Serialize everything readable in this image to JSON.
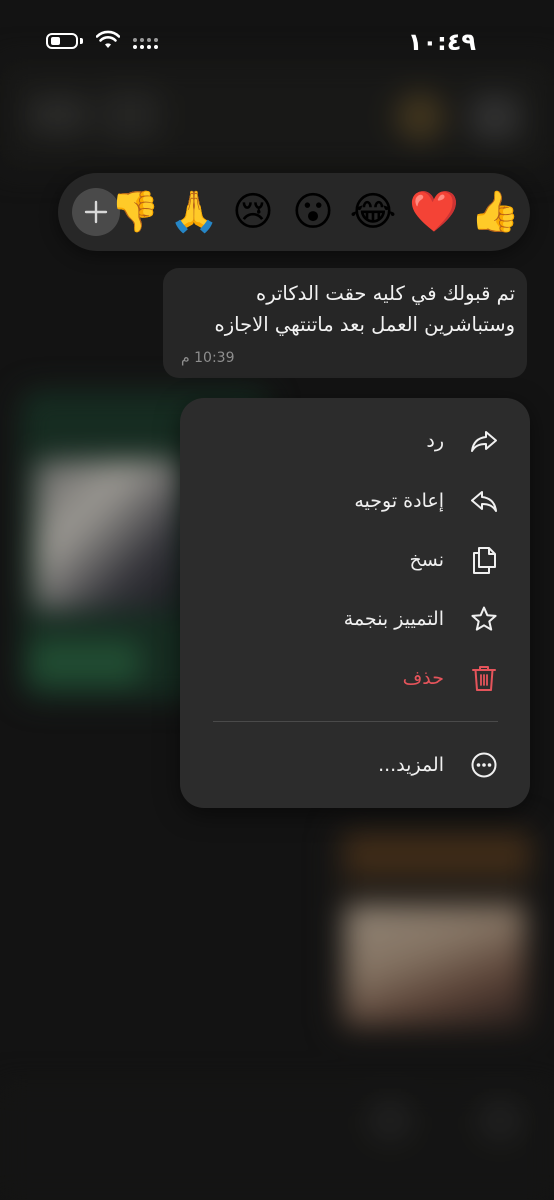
{
  "status_bar": {
    "time": "١٠:٤٩"
  },
  "reactions": [
    {
      "emoji": "👍",
      "icon": "thumbs-up"
    },
    {
      "emoji": "❤️",
      "icon": "red-heart"
    },
    {
      "emoji": "😂",
      "icon": "tears-of-joy"
    },
    {
      "emoji": "😮",
      "icon": "surprised-face"
    },
    {
      "emoji": "😢",
      "icon": "crying-face"
    },
    {
      "emoji": "🙏",
      "icon": "folded-hands"
    },
    {
      "emoji": "👎",
      "icon": "thumbs-down"
    }
  ],
  "message": {
    "line1": "تم قبولك في كليه حقت الدكاتره",
    "line2": "وستباشرين العمل بعد ماتنتهي الاجازه",
    "time": "10:39 م"
  },
  "menu": {
    "reply": "رد",
    "forward": "إعادة توجيه",
    "copy": "نسخ",
    "star": "التمييز بنجمة",
    "delete": "حذف",
    "more": "المزيد..."
  },
  "colors": {
    "delete": "#e5545b",
    "menu_bg": "#2c2c2c",
    "bubble_bg": "#262626"
  }
}
